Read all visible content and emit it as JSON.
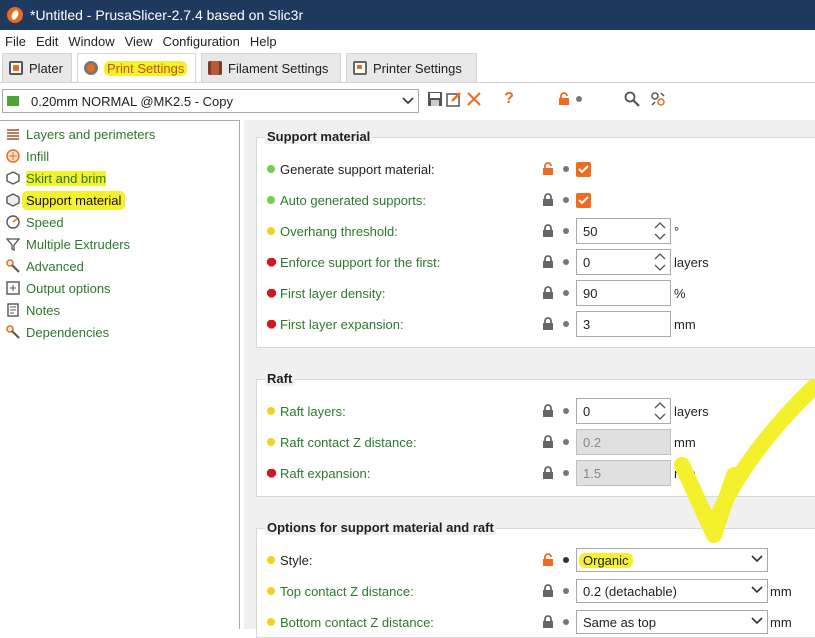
{
  "window": {
    "title": "*Untitled - PrusaSlicer-2.7.4 based on Slic3r"
  },
  "menu": [
    "File",
    "Edit",
    "Window",
    "View",
    "Configuration",
    "Help"
  ],
  "tabs": [
    "Plater",
    "Print Settings",
    "Filament Settings",
    "Printer Settings"
  ],
  "active_tab": "Print Settings",
  "preset": {
    "name": "0.20mm NORMAL @MK2.5 - Copy"
  },
  "toolbar_icons": [
    "save-icon",
    "rename-icon",
    "delete-icon",
    "help-icon",
    "lock-icon",
    "search-icon",
    "compare-icon"
  ],
  "sidebar": {
    "items": [
      {
        "label": "Layers and perimeters",
        "icon": "layers-icon"
      },
      {
        "label": "Infill",
        "icon": "infill-icon"
      },
      {
        "label": "Skirt and brim",
        "icon": "skirt-icon"
      },
      {
        "label": "Support material",
        "icon": "support-icon"
      },
      {
        "label": "Speed",
        "icon": "speed-icon"
      },
      {
        "label": "Multiple Extruders",
        "icon": "funnel-icon"
      },
      {
        "label": "Advanced",
        "icon": "wrench-icon"
      },
      {
        "label": "Output options",
        "icon": "output-icon"
      },
      {
        "label": "Notes",
        "icon": "notes-icon"
      },
      {
        "label": "Dependencies",
        "icon": "wrench-icon"
      }
    ],
    "selected": "Support material"
  },
  "support": {
    "title": "Support material",
    "generate_label": "Generate support material:",
    "auto_label": "Auto generated supports:",
    "overhang_label": "Overhang threshold:",
    "overhang_value": "50",
    "overhang_unit": "°",
    "enforce_label": "Enforce support for the first:",
    "enforce_value": "0",
    "enforce_unit": "layers",
    "density_label": "First layer density:",
    "density_value": "90",
    "density_unit": "%",
    "expansion_label": "First layer expansion:",
    "expansion_value": "3",
    "expansion_unit": "mm"
  },
  "raft": {
    "title": "Raft",
    "layers_label": "Raft layers:",
    "layers_value": "0",
    "layers_unit": "layers",
    "contact_label": "Raft contact Z distance:",
    "contact_value": "0.2",
    "contact_unit": "mm",
    "expansion_label": "Raft expansion:",
    "expansion_value": "1.5",
    "expansion_unit": "mm"
  },
  "options": {
    "title": "Options for support material and raft",
    "style_label": "Style:",
    "style_value": "Organic",
    "top_label": "Top contact Z distance:",
    "top_value": "0.2 (detachable)",
    "top_unit": "mm",
    "bottom_label": "Bottom contact Z distance:",
    "bottom_value": "Same as top",
    "bottom_unit": "mm"
  },
  "colors": {
    "accent": "#ed6b21",
    "highlight": "#f4f02c",
    "label_green": "#2b7a2b",
    "titlebar": "#1f3a5f"
  }
}
